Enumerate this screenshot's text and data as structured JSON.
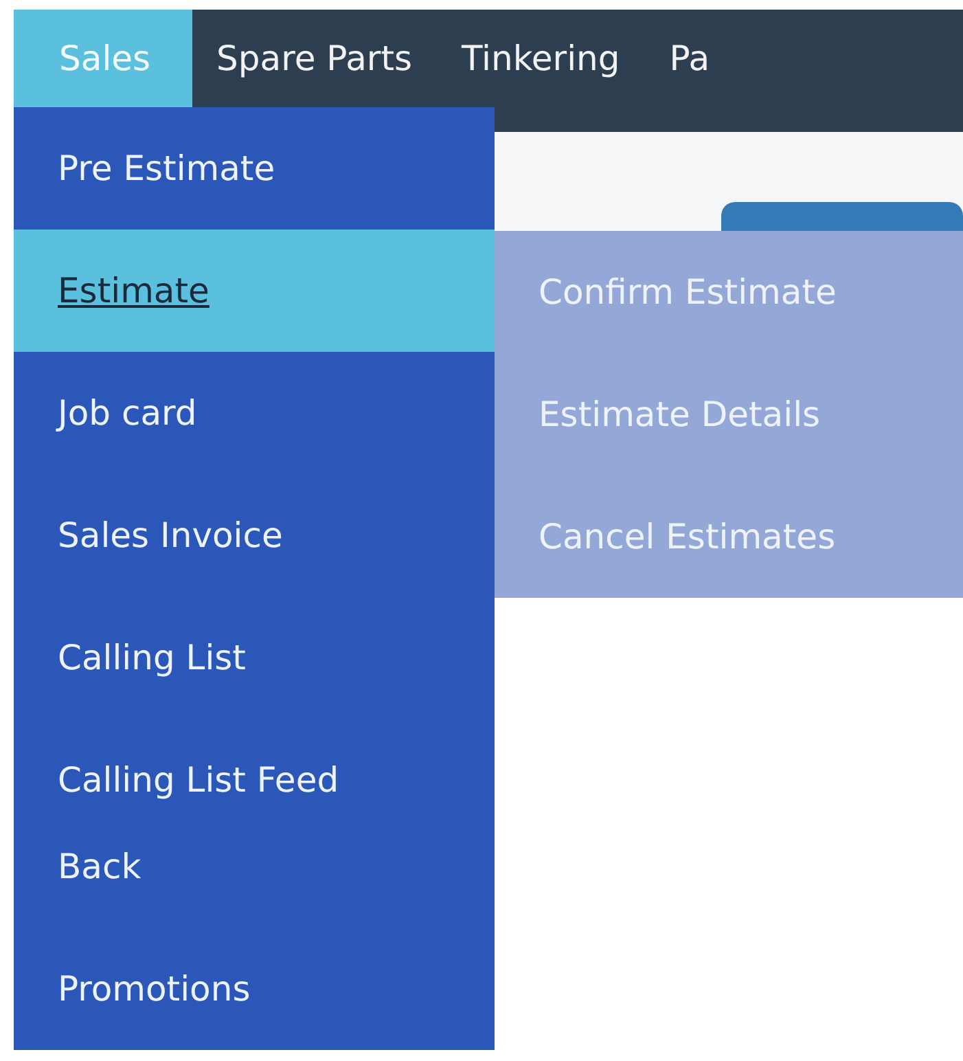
{
  "nav": {
    "items": [
      {
        "label": "Sales",
        "selected": true
      },
      {
        "label": "Spare Parts",
        "selected": false
      },
      {
        "label": "Tinkering",
        "selected": false
      },
      {
        "label": "Pa",
        "selected": false
      }
    ]
  },
  "dropdown": {
    "items": [
      {
        "label": "Pre Estimate",
        "selected": false
      },
      {
        "label": "Estimate",
        "selected": true
      },
      {
        "label": "Job card",
        "selected": false
      },
      {
        "label": "Sales Invoice",
        "selected": false
      },
      {
        "label": "Calling List",
        "selected": false
      },
      {
        "label": "Calling List Feed Back",
        "selected": false
      },
      {
        "label": "Promotions",
        "selected": false
      }
    ]
  },
  "submenu": {
    "items": [
      {
        "label": "Confirm Estimate"
      },
      {
        "label": "Estimate Details"
      },
      {
        "label": "Cancel Estimates"
      }
    ]
  }
}
